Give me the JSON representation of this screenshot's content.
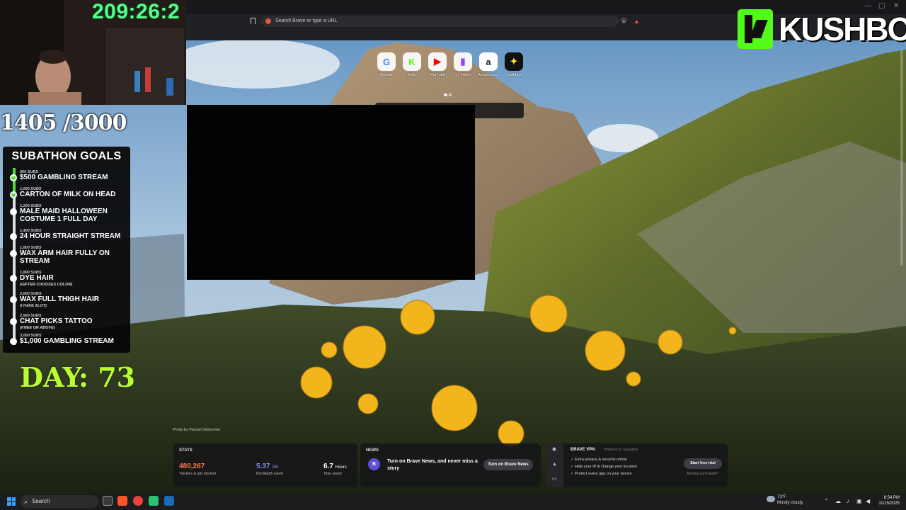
{
  "stream": {
    "timer": "209:26:2",
    "sub_counter": "1405 /3000",
    "day_label": "DAY: 73",
    "logo_text": "KUSHBOX",
    "goals_title": "SUBATHON GOALS",
    "goals": [
      {
        "subs": "500 SUBS",
        "text": "$500 GAMBLING STREAM",
        "note": "",
        "done": true
      },
      {
        "subs": "1,000 SUBS",
        "text": "CARTON OF MILK ON HEAD",
        "note": "",
        "done": true
      },
      {
        "subs": "1,200 SUBS",
        "text": "MALE MAID HALLOWEEN COSTUME 1 FULL DAY",
        "note": "",
        "done": false
      },
      {
        "subs": "1,400 SUBS",
        "text": "24 HOUR STRAIGHT STREAM",
        "note": "",
        "done": false
      },
      {
        "subs": "1,600 SUBS",
        "text": "WAX ARM HAIR FULLY ON STREAM",
        "note": "",
        "done": false
      },
      {
        "subs": "1,800 SUBS",
        "text": "DYE HAIR",
        "note": "(GIFTER CHOOSES COLOR)",
        "done": false
      },
      {
        "subs": "2,000 SUBS",
        "text": "WAX FULL THIGH HAIR",
        "note": "(I HAVE ALOT)",
        "done": false
      },
      {
        "subs": "2,500 SUBS",
        "text": "CHAT PICKS TATTOO",
        "note": "(KNEE OR ABOVE)",
        "done": false
      },
      {
        "subs": "3,000 SUBS",
        "text": "$1,000 GAMBLING STREAM",
        "note": "",
        "done": false
      }
    ]
  },
  "browser": {
    "address_placeholder": "Search Brave or type a URL",
    "window_controls": [
      "—",
      "▢",
      "✕"
    ],
    "top_sites": [
      {
        "label": "Google",
        "glyph": "G",
        "color": "#4285f4"
      },
      {
        "label": "Kick",
        "glyph": "K",
        "color": "#53fc18"
      },
      {
        "label": "YouTube",
        "glyph": "▶",
        "color": "#ff0000"
      },
      {
        "label": "(1) Twitch",
        "glyph": "▮",
        "color": "#9146ff"
      },
      {
        "label": "Amazon.co...",
        "glyph": "a",
        "color": "#222222"
      },
      {
        "label": "Kushbox",
        "glyph": "✦",
        "color": "#111111"
      }
    ],
    "photo_credit": "Photo by Pascal Debrunner",
    "stats": {
      "header": "STATS",
      "trackers_value": "480,267",
      "trackers_caption": "Trackers & ads blocked",
      "bandwidth_value": "5.37",
      "bandwidth_unit": "GB",
      "bandwidth_caption": "Bandwidth saved",
      "time_value": "6.7",
      "time_unit": "Hours",
      "time_caption": "Time saved"
    },
    "news": {
      "header": "NEWS",
      "text": "Turn on Brave News, and never miss a story",
      "button": "Turn on Brave News"
    },
    "vpn": {
      "title": "BRAVE VPN",
      "powered": "Powered by Guardian",
      "features": [
        "Extra privacy & security online",
        "Hide your IP & change your location",
        "Protect every app on your device"
      ],
      "button": "Start free trial",
      "already": "Already purchased?"
    }
  },
  "taskbar": {
    "search_placeholder": "Search",
    "weather_temp": "73°F",
    "weather_desc": "Mostly cloudy",
    "time": "8:54 PM",
    "date": "11/15/2025"
  },
  "colors": {
    "timer": "#53ff8b",
    "day": "#b9ff2e",
    "kick_green": "#53fc18",
    "trackers": "#ff7a45",
    "bandwidth": "#8a8cff"
  }
}
